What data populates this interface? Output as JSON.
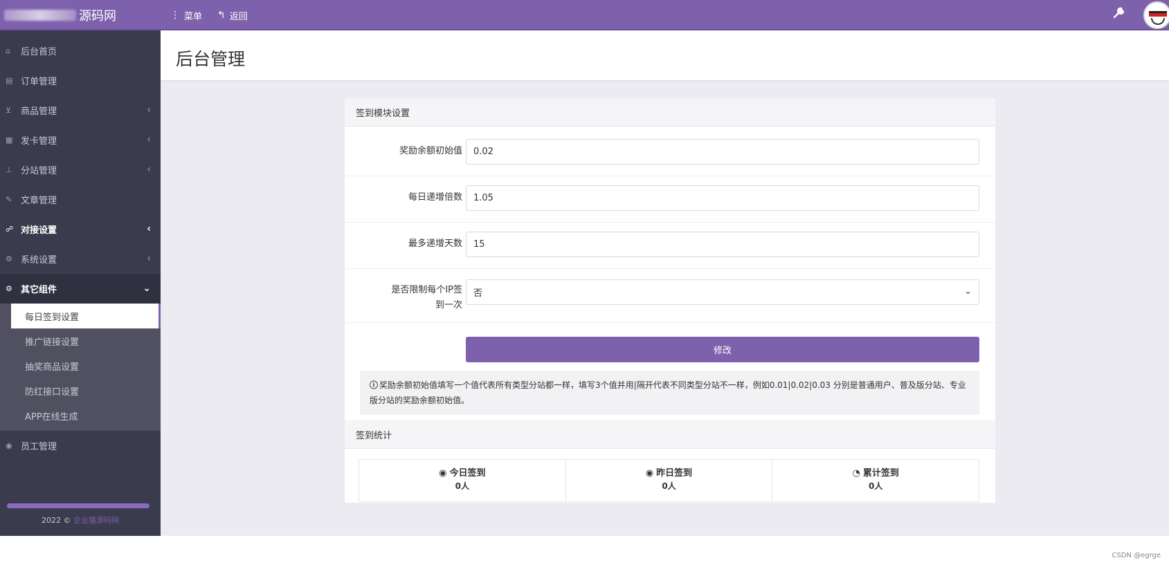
{
  "header": {
    "brand_suffix": "源码网",
    "nav": [
      {
        "icon": "ellipsis-vertical-icon",
        "glyph": "⋮",
        "label": "菜单"
      },
      {
        "icon": "reply-icon",
        "glyph": "↰",
        "label": "返回"
      }
    ],
    "tool_icon": "wrench-icon"
  },
  "sidebar": {
    "items": [
      {
        "icon": "home-icon",
        "label": "后台首页"
      },
      {
        "icon": "list-icon",
        "label": "订单管理"
      },
      {
        "icon": "cart-icon",
        "label": "商品管理"
      },
      {
        "icon": "grid-icon",
        "label": "发卡管理"
      },
      {
        "icon": "sitemap-icon",
        "label": "分站管理"
      },
      {
        "icon": "article-icon",
        "label": "文章管理"
      },
      {
        "icon": "link-icon",
        "label": "对接设置"
      },
      {
        "icon": "settings-icon",
        "label": "系统设置"
      },
      {
        "icon": "cogs-icon",
        "label": "其它组件"
      }
    ],
    "submenu": [
      "每日签到设置",
      "推广链接设置",
      "抽奖商品设置",
      "防红接口设置",
      "APP在线生成"
    ],
    "staff": "员工管理",
    "footer_year": "2022 ©",
    "footer_link": "企业猫源码网"
  },
  "page": {
    "title": "后台管理"
  },
  "signin_panel": {
    "title": "签到模块设置",
    "fields": [
      {
        "label": "奖励余额初始值",
        "value": "0.02"
      },
      {
        "label": "每日递增倍数",
        "value": "1.05"
      },
      {
        "label": "最多递增天数",
        "value": "15"
      }
    ],
    "ip_limit": {
      "label_line1": "是否限制每个IP签",
      "label_line2": "到一次",
      "value": "否"
    },
    "submit_label": "修改",
    "note": "奖励余额初始值填写一个值代表所有类型分站都一样，填写3个值并用|隔开代表不同类型分站不一样，例如0.01|0.02|0.03 分别是普通用户、普及版分站、专业版分站的奖励余额初始值。"
  },
  "stats_panel": {
    "title": "签到统计",
    "stats": [
      {
        "icon": "user-circle-icon",
        "label": "今日签到",
        "value": "0人"
      },
      {
        "icon": "user-circle-icon",
        "label": "昨日签到",
        "value": "0人"
      },
      {
        "icon": "pie-chart-icon",
        "label": "累计签到",
        "value": "0人"
      }
    ]
  },
  "watermark": "CSDN @egrge"
}
